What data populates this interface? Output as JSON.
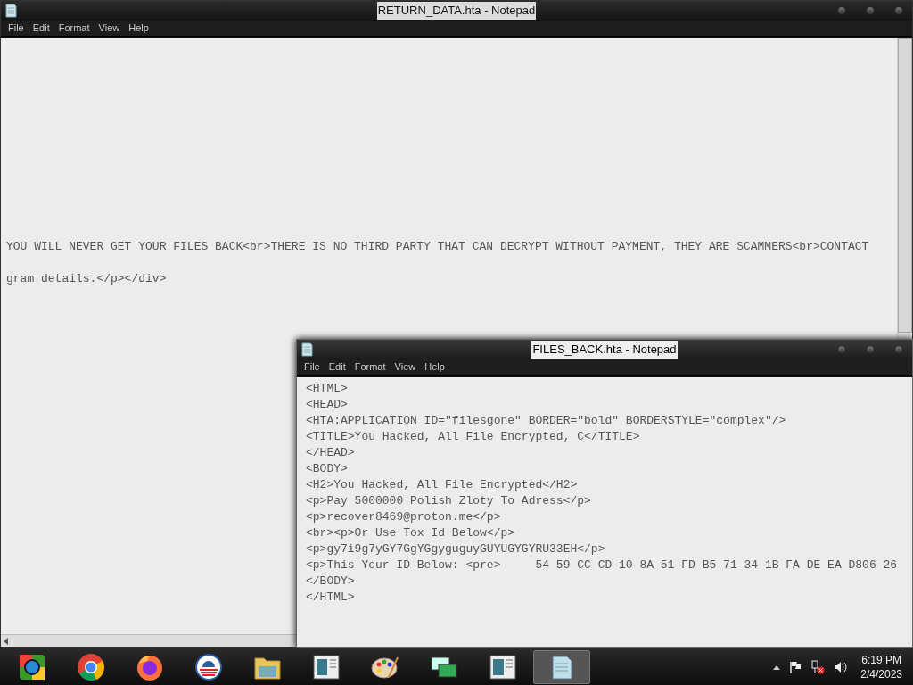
{
  "windows": [
    {
      "title": "RETURN_DATA.hta - Notepad",
      "menu": [
        "File",
        "Edit",
        "Format",
        "View",
        "Help"
      ],
      "lines": [
        "YOU WILL NEVER GET YOUR FILES BACK<br>THERE IS NO THIRD PARTY THAT CAN DECRYPT WITHOUT PAYMENT, THEY ARE SCAMMERS<br>CONTACT",
        "gram details.</p></div>"
      ],
      "active": false
    },
    {
      "title": "FILES_BACK.hta - Notepad",
      "menu": [
        "File",
        "Edit",
        "Format",
        "View",
        "Help"
      ],
      "lines": [
        "<HTML>",
        "<HEAD>",
        "<HTA:APPLICATION ID=\"filesgone\" BORDER=\"bold\" BORDERSTYLE=\"complex\"/>",
        "<TITLE>You Hacked, All File Encrypted, C</TITLE>",
        "</HEAD>",
        "<BODY>",
        "<H2>You Hacked, All File Encrypted</H2>",
        "<p>Pay 5000000 Polish Zloty To Adress</p>",
        "<p>recover8469@proton.me</p>",
        "<br><p>Or Use Tox Id Below</p>",
        "<p>gy7i9g7yGY7GgYGgyguguyGUYUGYGYRU33EH</p>",
        "<p>This Your ID Below: <pre>     54 59 CC CD 10 8A 51 FD B5 71 34 1B FA DE EA D806 26",
        "</BODY>",
        "</HTML>"
      ],
      "active": true
    }
  ],
  "taskbar": {
    "items": [
      {
        "kind": "media",
        "selected": false
      },
      {
        "kind": "chrome",
        "selected": false
      },
      {
        "kind": "firefox",
        "selected": false
      },
      {
        "kind": "circle",
        "selected": false
      },
      {
        "kind": "folder",
        "selected": false
      },
      {
        "kind": "window",
        "selected": false
      },
      {
        "kind": "paint",
        "selected": false
      },
      {
        "kind": "network",
        "selected": false
      },
      {
        "kind": "window",
        "selected": false
      },
      {
        "kind": "notepad",
        "selected": true
      }
    ],
    "clock": {
      "time": "6:19 PM",
      "date": "2/4/2023"
    }
  }
}
